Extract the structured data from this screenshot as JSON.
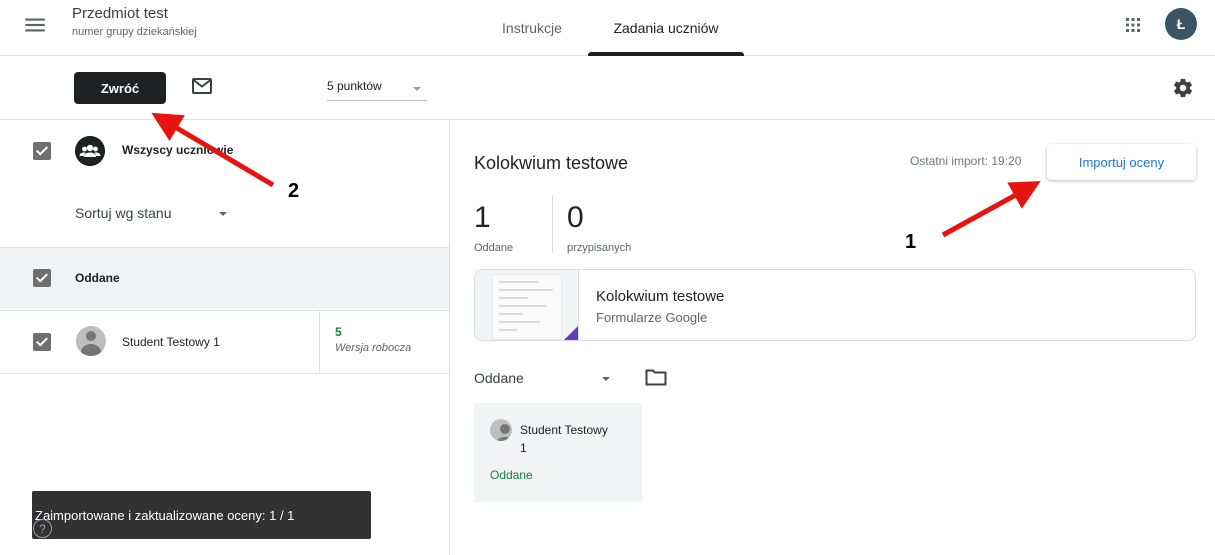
{
  "header": {
    "class_title": "Przedmiot test",
    "class_subtitle": "numer grupy dziekańskiej",
    "tabs": [
      {
        "label": "Instrukcje",
        "active": false
      },
      {
        "label": "Zadania uczniów",
        "active": true
      }
    ],
    "avatar_initial": "Ł",
    "icons": {
      "menu": "hamburger-menu-icon",
      "apps": "apps-grid-icon"
    }
  },
  "toolbar": {
    "return_label": "Zwróć",
    "points_value": "5 punktów",
    "icons": {
      "mail": "mail-icon",
      "settings": "gear-icon"
    }
  },
  "left_panel": {
    "all_students_label": "Wszyscy uczniowie",
    "sort_label": "Sortuj wg stanu",
    "section_label": "Oddane",
    "students": [
      {
        "name": "Student Testowy 1",
        "grade": "5",
        "grade_status": "Wersja robocza"
      }
    ]
  },
  "assignment": {
    "title": "Kolokwium testowe",
    "last_import": "Ostatni import: 19:20",
    "import_label": "Importuj oceny",
    "stats": [
      {
        "value": "1",
        "label": "Oddane"
      },
      {
        "value": "0",
        "label": "przypisanych"
      }
    ],
    "attachment": {
      "title": "Kolokwium testowe",
      "type": "Formularze Google"
    },
    "filter_label": "Oddane",
    "card": {
      "name_line1": "Student Testowy",
      "name_line2": "1",
      "status": "Oddane"
    }
  },
  "toast": {
    "message": "Zaimportowane i zaktualizowane oceny: 1 / 1"
  },
  "help": {
    "symbol": "?"
  },
  "annotations": {
    "arrow1_number": "1",
    "arrow2_number": "2",
    "color": "#e6130f"
  },
  "colors": {
    "accent": "#1a73e8",
    "returned_green": "#188038",
    "dark_button": "#202124"
  }
}
